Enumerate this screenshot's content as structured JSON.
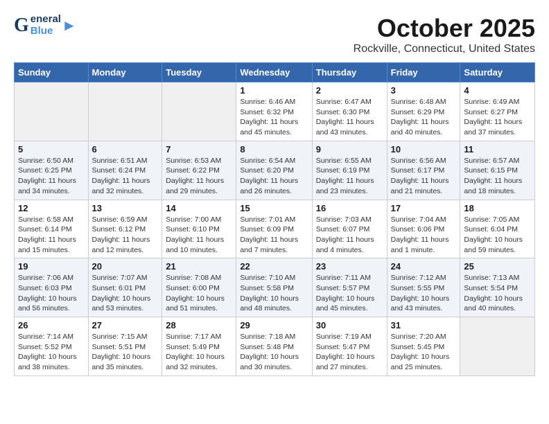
{
  "header": {
    "logo_g": "G",
    "logo_line1": "eneral",
    "logo_line2": "Blue",
    "month_title": "October 2025",
    "location": "Rockville, Connecticut, United States"
  },
  "days_of_week": [
    "Sunday",
    "Monday",
    "Tuesday",
    "Wednesday",
    "Thursday",
    "Friday",
    "Saturday"
  ],
  "weeks": [
    [
      {
        "num": "",
        "info": "",
        "empty": true
      },
      {
        "num": "",
        "info": "",
        "empty": true
      },
      {
        "num": "",
        "info": "",
        "empty": true
      },
      {
        "num": "1",
        "info": "Sunrise: 6:46 AM\nSunset: 6:32 PM\nDaylight: 11 hours and 45 minutes.",
        "empty": false
      },
      {
        "num": "2",
        "info": "Sunrise: 6:47 AM\nSunset: 6:30 PM\nDaylight: 11 hours and 43 minutes.",
        "empty": false
      },
      {
        "num": "3",
        "info": "Sunrise: 6:48 AM\nSunset: 6:29 PM\nDaylight: 11 hours and 40 minutes.",
        "empty": false
      },
      {
        "num": "4",
        "info": "Sunrise: 6:49 AM\nSunset: 6:27 PM\nDaylight: 11 hours and 37 minutes.",
        "empty": false
      }
    ],
    [
      {
        "num": "5",
        "info": "Sunrise: 6:50 AM\nSunset: 6:25 PM\nDaylight: 11 hours and 34 minutes.",
        "empty": false
      },
      {
        "num": "6",
        "info": "Sunrise: 6:51 AM\nSunset: 6:24 PM\nDaylight: 11 hours and 32 minutes.",
        "empty": false
      },
      {
        "num": "7",
        "info": "Sunrise: 6:53 AM\nSunset: 6:22 PM\nDaylight: 11 hours and 29 minutes.",
        "empty": false
      },
      {
        "num": "8",
        "info": "Sunrise: 6:54 AM\nSunset: 6:20 PM\nDaylight: 11 hours and 26 minutes.",
        "empty": false
      },
      {
        "num": "9",
        "info": "Sunrise: 6:55 AM\nSunset: 6:19 PM\nDaylight: 11 hours and 23 minutes.",
        "empty": false
      },
      {
        "num": "10",
        "info": "Sunrise: 6:56 AM\nSunset: 6:17 PM\nDaylight: 11 hours and 21 minutes.",
        "empty": false
      },
      {
        "num": "11",
        "info": "Sunrise: 6:57 AM\nSunset: 6:15 PM\nDaylight: 11 hours and 18 minutes.",
        "empty": false
      }
    ],
    [
      {
        "num": "12",
        "info": "Sunrise: 6:58 AM\nSunset: 6:14 PM\nDaylight: 11 hours and 15 minutes.",
        "empty": false
      },
      {
        "num": "13",
        "info": "Sunrise: 6:59 AM\nSunset: 6:12 PM\nDaylight: 11 hours and 12 minutes.",
        "empty": false
      },
      {
        "num": "14",
        "info": "Sunrise: 7:00 AM\nSunset: 6:10 PM\nDaylight: 11 hours and 10 minutes.",
        "empty": false
      },
      {
        "num": "15",
        "info": "Sunrise: 7:01 AM\nSunset: 6:09 PM\nDaylight: 11 hours and 7 minutes.",
        "empty": false
      },
      {
        "num": "16",
        "info": "Sunrise: 7:03 AM\nSunset: 6:07 PM\nDaylight: 11 hours and 4 minutes.",
        "empty": false
      },
      {
        "num": "17",
        "info": "Sunrise: 7:04 AM\nSunset: 6:06 PM\nDaylight: 11 hours and 1 minute.",
        "empty": false
      },
      {
        "num": "18",
        "info": "Sunrise: 7:05 AM\nSunset: 6:04 PM\nDaylight: 10 hours and 59 minutes.",
        "empty": false
      }
    ],
    [
      {
        "num": "19",
        "info": "Sunrise: 7:06 AM\nSunset: 6:03 PM\nDaylight: 10 hours and 56 minutes.",
        "empty": false
      },
      {
        "num": "20",
        "info": "Sunrise: 7:07 AM\nSunset: 6:01 PM\nDaylight: 10 hours and 53 minutes.",
        "empty": false
      },
      {
        "num": "21",
        "info": "Sunrise: 7:08 AM\nSunset: 6:00 PM\nDaylight: 10 hours and 51 minutes.",
        "empty": false
      },
      {
        "num": "22",
        "info": "Sunrise: 7:10 AM\nSunset: 5:58 PM\nDaylight: 10 hours and 48 minutes.",
        "empty": false
      },
      {
        "num": "23",
        "info": "Sunrise: 7:11 AM\nSunset: 5:57 PM\nDaylight: 10 hours and 45 minutes.",
        "empty": false
      },
      {
        "num": "24",
        "info": "Sunrise: 7:12 AM\nSunset: 5:55 PM\nDaylight: 10 hours and 43 minutes.",
        "empty": false
      },
      {
        "num": "25",
        "info": "Sunrise: 7:13 AM\nSunset: 5:54 PM\nDaylight: 10 hours and 40 minutes.",
        "empty": false
      }
    ],
    [
      {
        "num": "26",
        "info": "Sunrise: 7:14 AM\nSunset: 5:52 PM\nDaylight: 10 hours and 38 minutes.",
        "empty": false
      },
      {
        "num": "27",
        "info": "Sunrise: 7:15 AM\nSunset: 5:51 PM\nDaylight: 10 hours and 35 minutes.",
        "empty": false
      },
      {
        "num": "28",
        "info": "Sunrise: 7:17 AM\nSunset: 5:49 PM\nDaylight: 10 hours and 32 minutes.",
        "empty": false
      },
      {
        "num": "29",
        "info": "Sunrise: 7:18 AM\nSunset: 5:48 PM\nDaylight: 10 hours and 30 minutes.",
        "empty": false
      },
      {
        "num": "30",
        "info": "Sunrise: 7:19 AM\nSunset: 5:47 PM\nDaylight: 10 hours and 27 minutes.",
        "empty": false
      },
      {
        "num": "31",
        "info": "Sunrise: 7:20 AM\nSunset: 5:45 PM\nDaylight: 10 hours and 25 minutes.",
        "empty": false
      },
      {
        "num": "",
        "info": "",
        "empty": true
      }
    ]
  ]
}
